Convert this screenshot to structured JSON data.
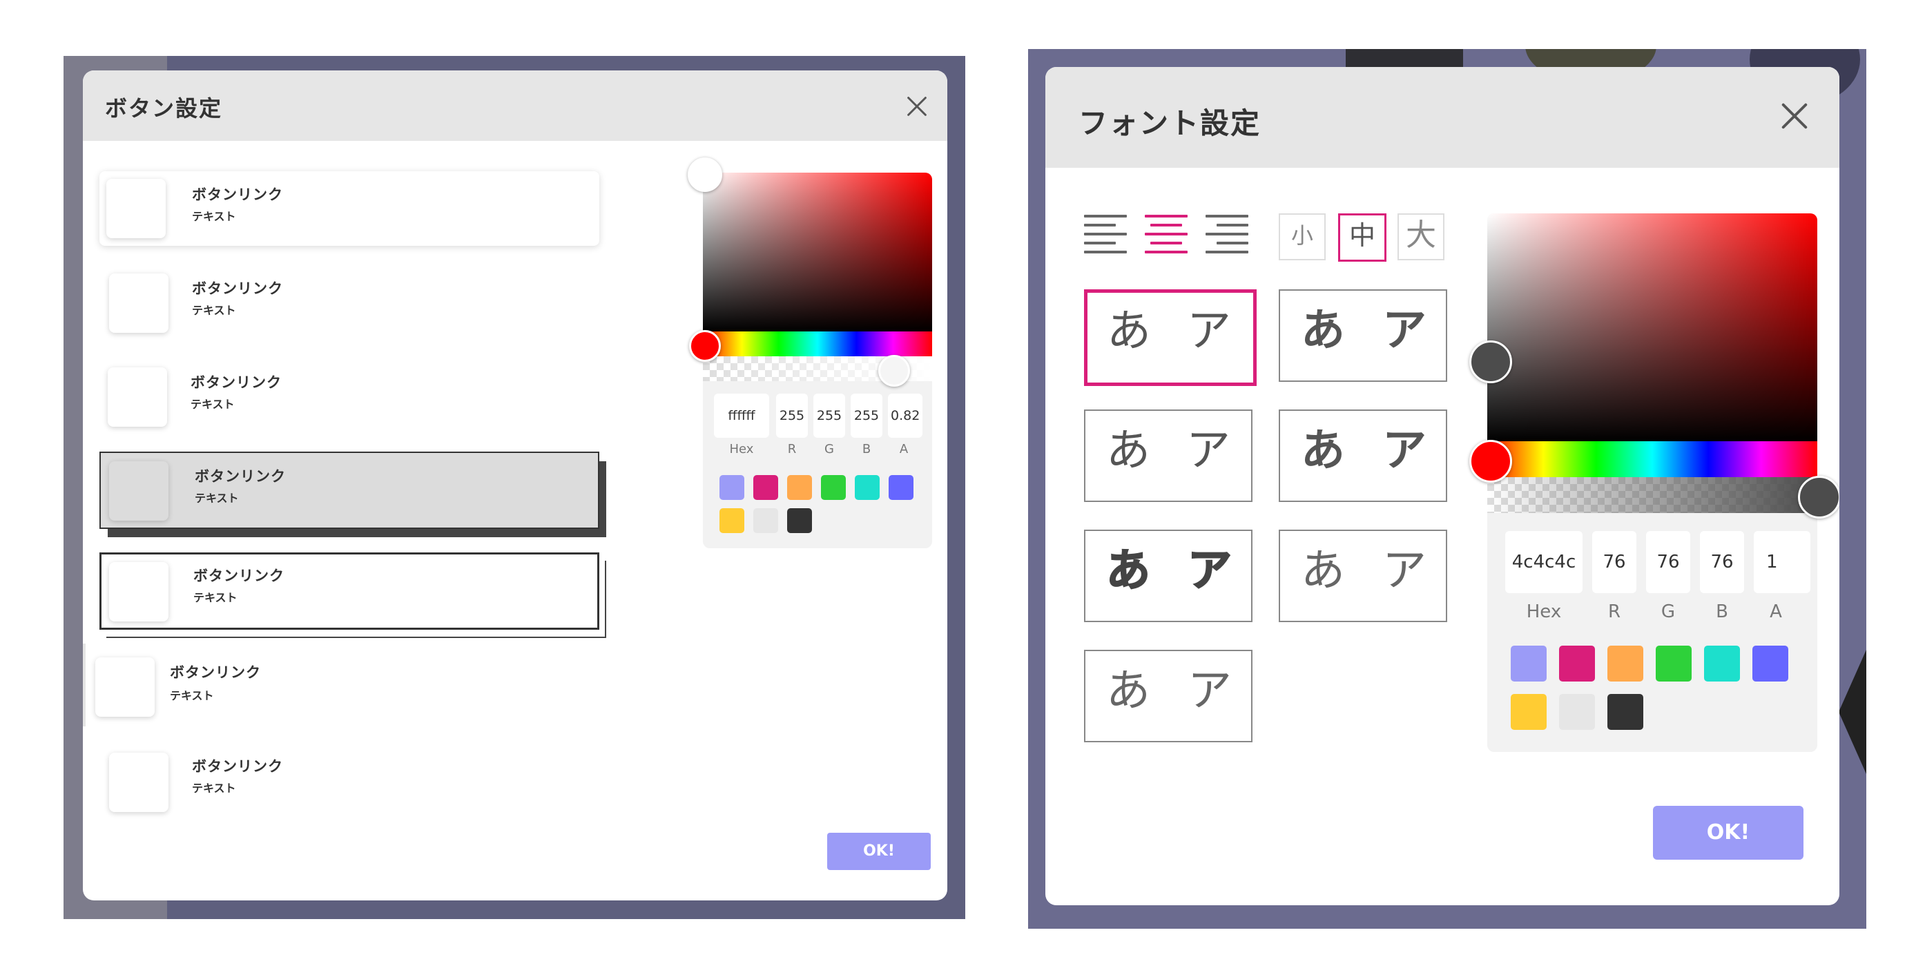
{
  "button_modal": {
    "title": "ボタン設定",
    "options": [
      {
        "label": "ボタンリンク",
        "sub": "テキスト"
      },
      {
        "label": "ボタンリンク",
        "sub": "テキスト"
      },
      {
        "label": "ボタンリンク",
        "sub": "テキスト"
      },
      {
        "label": "ボタンリンク",
        "sub": "テキスト"
      },
      {
        "label": "ボタンリンク",
        "sub": "テキスト"
      },
      {
        "label": "ボタンリンク",
        "sub": "テキスト"
      },
      {
        "label": "ボタンリンク",
        "sub": "テキスト"
      }
    ],
    "ok_label": "OK!",
    "picker": {
      "hex": "ffffff",
      "r": "255",
      "g": "255",
      "b": "255",
      "a": "0.82",
      "labels": {
        "hex": "Hex",
        "r": "R",
        "g": "G",
        "b": "B",
        "a": "A"
      }
    }
  },
  "font_modal": {
    "title": "フォント設定",
    "sizes": [
      "小",
      "中",
      "大"
    ],
    "selected_size": "中",
    "selected_align": "center",
    "samples": [
      {
        "hira": "あ",
        "kata": "ア",
        "weight": "regular",
        "selected": true
      },
      {
        "hira": "あ",
        "kata": "ア",
        "weight": "bold"
      },
      {
        "hira": "あ",
        "kata": "ア",
        "weight": "regular"
      },
      {
        "hira": "あ",
        "kata": "ア",
        "weight": "bold"
      },
      {
        "hira": "あ",
        "kata": "ア",
        "weight": "black"
      },
      {
        "hira": "あ",
        "kata": "ア",
        "weight": "thin"
      },
      {
        "hira": "あ",
        "kata": "ア",
        "weight": "thin"
      }
    ],
    "ok_label": "OK!",
    "picker": {
      "hex": "4c4c4c",
      "r": "76",
      "g": "76",
      "b": "76",
      "a": "1",
      "labels": {
        "hex": "Hex",
        "r": "R",
        "g": "G",
        "b": "B",
        "a": "A"
      }
    }
  },
  "swatch_colors": [
    "#9b9bf7",
    "#d91e7a",
    "#ffa94d",
    "#2ed13a",
    "#1ddfcc",
    "#6666ff",
    "#ffcc33",
    "#e6e6e6",
    "#333333"
  ],
  "colors": {
    "accent": "#d91e7a",
    "ok_button": "#9b9bf7",
    "header": "#e6e6e6",
    "hue_handle": "#ff0000"
  }
}
